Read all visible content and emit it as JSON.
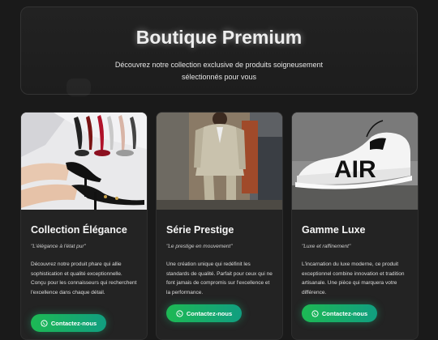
{
  "hero": {
    "title": "Boutique Premium",
    "subtitle": "Découvrez notre collection exclusive de produits soigneusement sélectionnés pour vous"
  },
  "cards": [
    {
      "title": "Collection Élégance",
      "tagline": "\"L'élégance à l'état pur\"",
      "description": "Découvrez notre produit phare qui allie sophistication et qualité exceptionnelle. Conçu pour les connaisseurs qui recherchent l'excellence dans chaque détail.",
      "button": "Contactez-nous",
      "image_icon": "high-heels-image"
    },
    {
      "title": "Série Prestige",
      "tagline": "\"Le prestige en mouvement\"",
      "description": "Une création unique qui redéfinit les standards de qualité. Parfait pour ceux qui ne font jamais de compromis sur l'excellence et la performance.",
      "button": "Contactez-nous",
      "image_icon": "man-in-suit-image"
    },
    {
      "title": "Gamme Luxe",
      "tagline": "\"Luxe et raffinement\"",
      "description": "L'incarnation du luxe moderne, ce produit exceptionnel combine innovation et tradition artisanale. Une pièce qui marquera votre différence.",
      "button": "Contactez-nous",
      "image_icon": "sneaker-image",
      "image_text": "AIR"
    }
  ],
  "colors": {
    "background": "#1a1a1a",
    "card": "#232323",
    "button_start": "#1db954",
    "button_end": "#119e80"
  }
}
